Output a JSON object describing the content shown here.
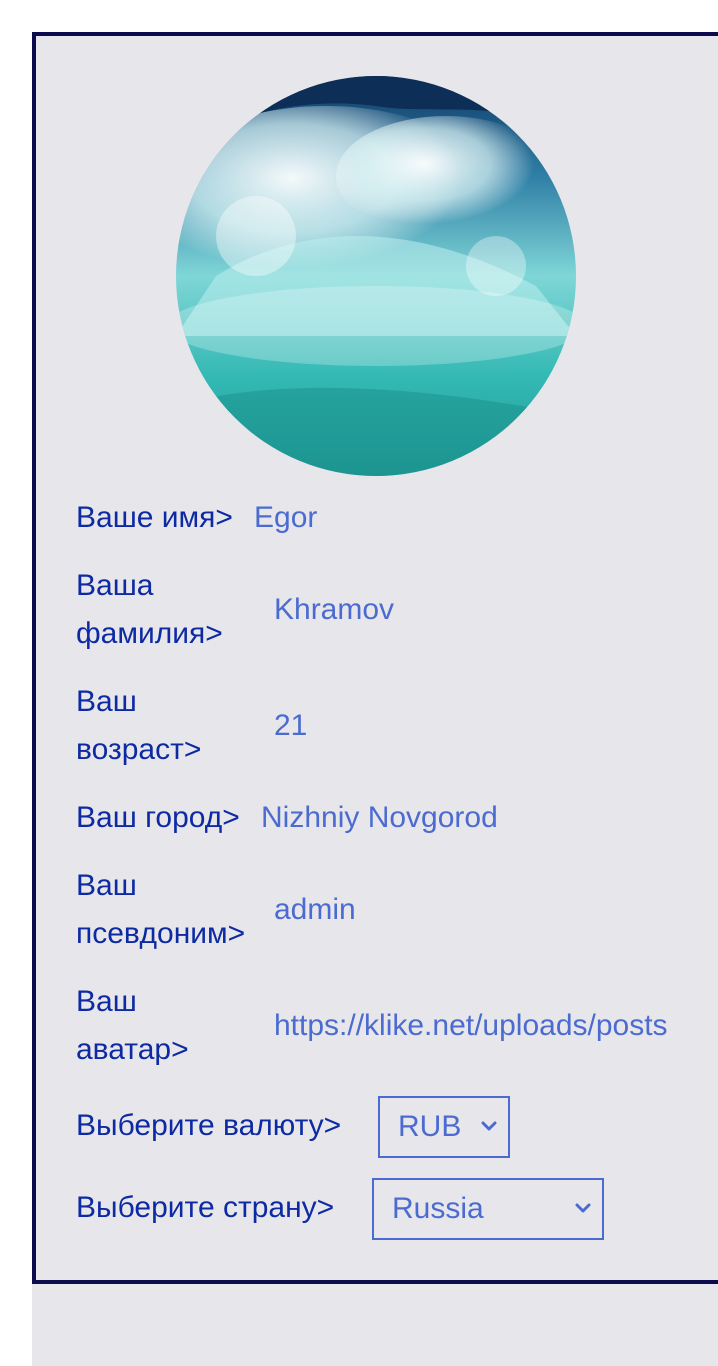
{
  "profile": {
    "avatar_name": "wave-avatar",
    "fields": [
      {
        "label_1": "Ваше имя>",
        "label_2": "",
        "value": "Egor"
      },
      {
        "label_1": "Ваша",
        "label_2": "фамилия>",
        "value": "Khramov"
      },
      {
        "label_1": "Ваш",
        "label_2": "возраст>",
        "value": "21"
      },
      {
        "label_1": "Ваш город>",
        "label_2": "",
        "value": "Nizhniy Novgorod"
      },
      {
        "label_1": "Ваш",
        "label_2": "псевдоним>",
        "value": "admin"
      },
      {
        "label_1": "Ваш",
        "label_2": "аватар>",
        "value": "https://klike.net/uploads/posts"
      }
    ],
    "currency": {
      "label": "Выберите валюту>",
      "selected": "RUB"
    },
    "country": {
      "label": "Выберите страну>",
      "selected": "Russia"
    }
  },
  "colors": {
    "label": "#0d2aa3",
    "value": "#4b6bd0",
    "border": "#0b0b4d",
    "background": "#e7e6ea"
  }
}
